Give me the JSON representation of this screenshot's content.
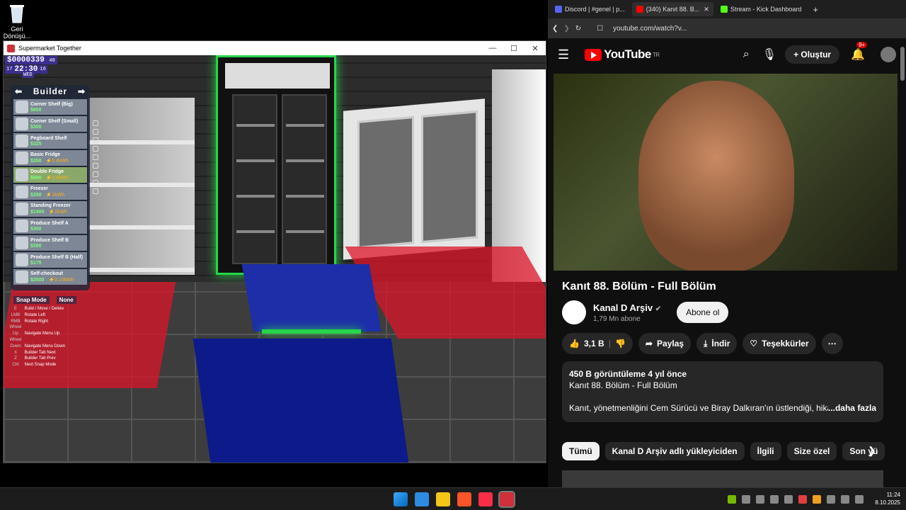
{
  "desktop": {
    "recycle_bin_label": "Geri Dönüşü..."
  },
  "game_window": {
    "title": "Supermarket Together",
    "hud": {
      "money": "$0000339",
      "money_suffix": "40",
      "day_left": "17",
      "time": "22:30",
      "day_right": "16",
      "weekday": "WED"
    },
    "builder": {
      "title": "Builder",
      "items": [
        {
          "name": "Corner Shelf (Big)",
          "price": "$600",
          "power": ""
        },
        {
          "name": "Corner Shelf (Small)",
          "price": "$300",
          "power": ""
        },
        {
          "name": "Pegboard Shelf",
          "price": "$325",
          "power": ""
        },
        {
          "name": "Basic Fridge",
          "price": "$350",
          "power": "⚡0.4kWh"
        },
        {
          "name": "Double Fridge",
          "price": "$600",
          "power": "⚡0.8kWh"
        },
        {
          "name": "Freezer",
          "price": "$350",
          "power": "⚡1kWh"
        },
        {
          "name": "Standing Freezer",
          "price": "$1400",
          "power": "⚡2kWh"
        },
        {
          "name": "Produce Shelf A",
          "price": "$300",
          "power": ""
        },
        {
          "name": "Produce Shelf B",
          "price": "$300",
          "power": ""
        },
        {
          "name": "Produce Shelf B (Half)",
          "price": "$175",
          "power": ""
        },
        {
          "name": "Self-checkout",
          "price": "$2500",
          "power": "⚡0.15kWh"
        }
      ],
      "selected_index": 4
    },
    "snap_label": "Snap Mode",
    "snap_value": "None",
    "keybinds": [
      {
        "key": "E",
        "action": "Build / Move / Delete"
      },
      {
        "key": "LMB",
        "action": "Rotate Left"
      },
      {
        "key": "RMB",
        "action": "Rotate Right"
      },
      {
        "key": "Wheel Up",
        "action": "Navigate Menu Up"
      },
      {
        "key": "Wheel Down",
        "action": "Navigate Menu Down"
      },
      {
        "key": "X",
        "action": "Builder Tab Next"
      },
      {
        "key": "Z",
        "action": "Builder Tab Prev"
      },
      {
        "key": "Ctrl",
        "action": "Next Snap Mode"
      }
    ]
  },
  "browser": {
    "tabs": [
      {
        "label": "Discord | #genel | p...",
        "color": "#5865f2",
        "active": false
      },
      {
        "label": "(340) Kanıt 88. B...",
        "color": "#ff0000",
        "active": true
      },
      {
        "label": "Stream - Kick Dashboard",
        "color": "#53fc18",
        "active": false
      }
    ],
    "url": "youtube.com/watch?v...",
    "youtube": {
      "logo_text": "YouTube",
      "region": "TR",
      "create_label": "Oluştur",
      "notif_count": "9+",
      "video_title": "Kanıt 88. Bölüm - Full Bölüm",
      "channel_name": "Kanal D Arşiv",
      "subscribers": "1,79 Mn abone",
      "subscribe_label": "Abone ol",
      "likes": "3,1 B",
      "share_label": "Paylaş",
      "download_label": "İndir",
      "thanks_label": "Teşekkürler",
      "description": {
        "meta": "450 B görüntüleme  4 yıl önce",
        "title_line": "Kanıt 88. Bölüm - Full Bölüm",
        "text": "Kanıt, yönetmenliğini Cem Sürücü ve Biray Dalkıran'ın üstlendiği, hikâyesi",
        "more_label": "...daha fazla"
      },
      "chips": [
        {
          "label": "Tümü",
          "active": true
        },
        {
          "label": "Kanal D Arşiv adlı yükleyiciden",
          "active": false
        },
        {
          "label": "İlgili",
          "active": false
        },
        {
          "label": "Size özel",
          "active": false
        },
        {
          "label": "Son yü",
          "active": false
        }
      ]
    }
  },
  "taskbar": {
    "time": "11:24",
    "date": "8.10.2025"
  }
}
